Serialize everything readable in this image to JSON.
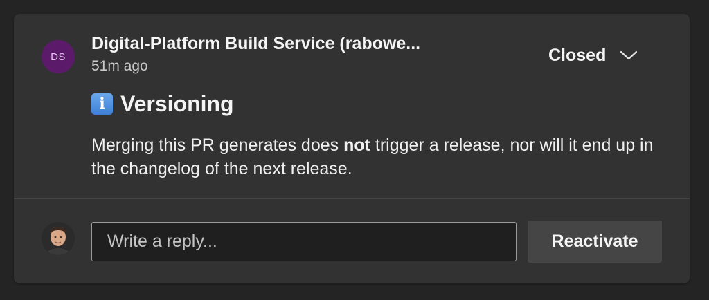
{
  "comment": {
    "author_initials": "DS",
    "author_name": "Digital-Platform Build Service (rabowe...",
    "timestamp": "51m ago",
    "status": "Closed",
    "status_icon": "chevron-down-icon",
    "heading_icon": "info-icon",
    "heading_icon_glyph": "i",
    "heading": "Versioning",
    "message_before": "Merging this PR generates does ",
    "message_bold": "not",
    "message_after": " trigger a release, nor will it end up in the changelog of the next release."
  },
  "reply": {
    "placeholder": "Write a reply...",
    "value": "",
    "reactivate_label": "Reactivate"
  },
  "colors": {
    "background": "#242424",
    "card": "#323232",
    "avatar_ds": "#5c1a6b",
    "button": "#454545",
    "info_icon": "#4a8ee0"
  }
}
